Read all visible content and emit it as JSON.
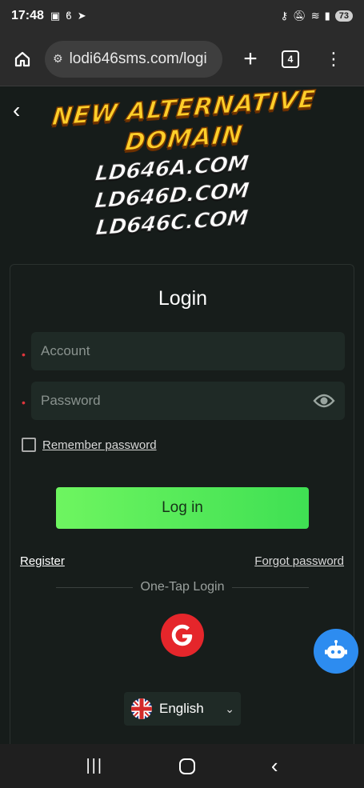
{
  "status_bar": {
    "time": "17:48",
    "battery": "73"
  },
  "browser": {
    "url": "lodi646sms.com/logi",
    "tab_count": "4"
  },
  "banner": {
    "line1": "NEW ALTERNATIVE",
    "line2": "DOMAIN",
    "domains": [
      "LD646A.COM",
      "LD646D.COM",
      "LD646C.COM"
    ]
  },
  "login": {
    "title": "Login",
    "account_placeholder": "Account",
    "password_placeholder": "Password",
    "remember_label": "Remember password",
    "login_button": "Log in",
    "register_link": "Register",
    "forgot_link": "Forgot password",
    "one_tap_label": "One-Tap Login",
    "language": "English"
  },
  "colors": {
    "accent": "#4de85a",
    "google": "#e5262b",
    "bot": "#2d8cf0"
  }
}
